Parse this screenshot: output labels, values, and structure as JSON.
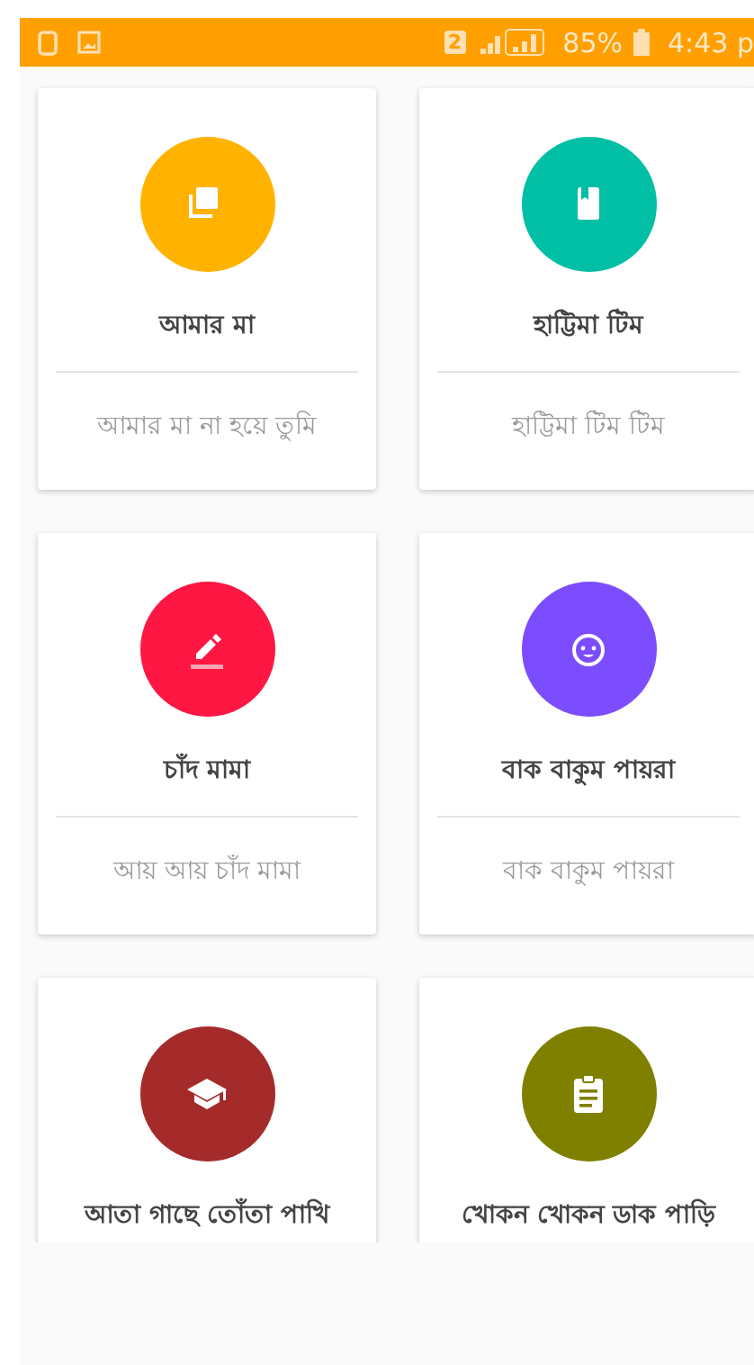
{
  "status_bar": {
    "sim_slot": "2",
    "battery": "85%",
    "time": "4:43 p"
  },
  "cards": [
    {
      "title": "আমার মা",
      "subtitle": "আমার মা না হয়ে তুমি",
      "color": "#ffb300"
    },
    {
      "title": "হাট্টিমা টিম",
      "subtitle": "হাট্টিমা টিম টিম",
      "color": "#00bfa5"
    },
    {
      "title": "চাঁদ মামা",
      "subtitle": "আয় আয় চাঁদ মামা",
      "color": "#ff1744"
    },
    {
      "title": "বাক বাকুম পায়রা",
      "subtitle": "বাক বাকুম পায়রা",
      "color": "#7c4dff"
    },
    {
      "title": "আতা গাছে তোঁতা পাখি",
      "color": "#a52a2a"
    },
    {
      "title": "খোকন খোকন ডাক পাড়ি",
      "color": "#808000"
    }
  ]
}
